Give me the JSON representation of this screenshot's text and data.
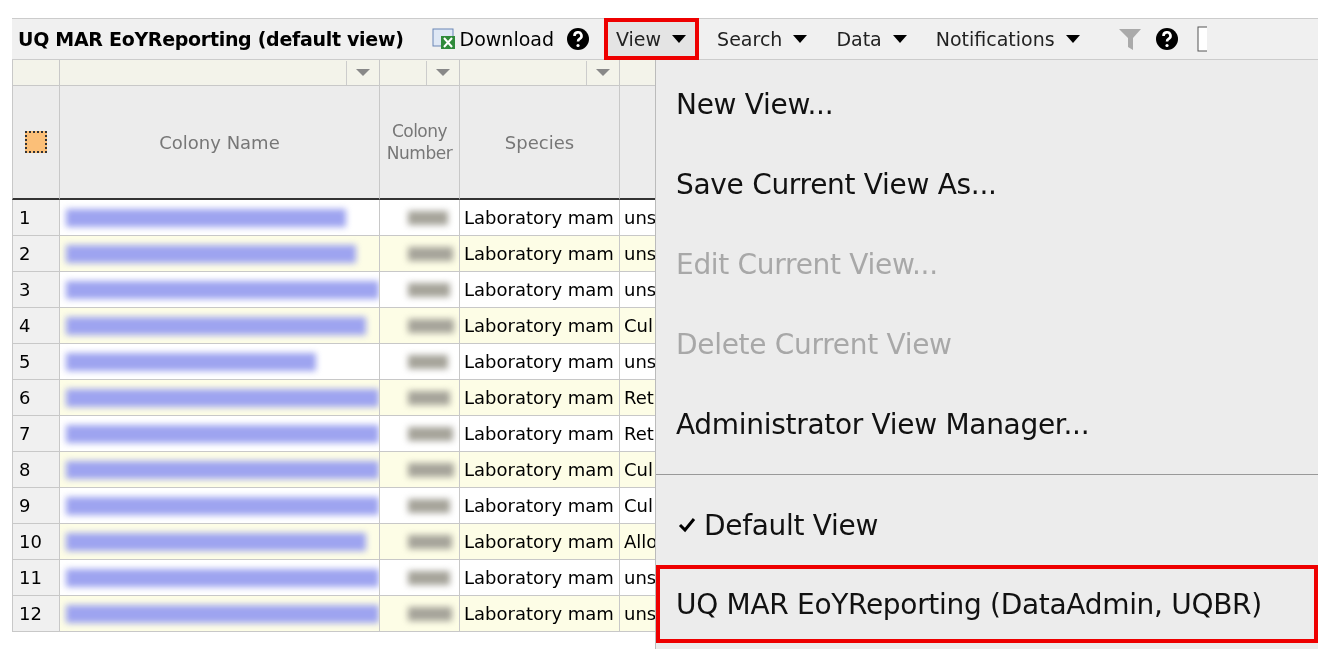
{
  "toolbar": {
    "title": "UQ MAR EoYReporting (default view)",
    "download": "Download",
    "menus": [
      {
        "label": "View",
        "selected": true,
        "outlined": true
      },
      {
        "label": "Search",
        "selected": false,
        "outlined": false
      },
      {
        "label": "Data",
        "selected": false,
        "outlined": false
      },
      {
        "label": "Notifications",
        "selected": false,
        "outlined": false
      }
    ]
  },
  "table": {
    "select_all_checked": false,
    "columns": [
      "Colony Name",
      "Colony Number",
      "Species"
    ],
    "rows": [
      {
        "num": "1",
        "species": "Laboratory mam",
        "column_5": "uns"
      },
      {
        "num": "2",
        "species": "Laboratory mam",
        "column_5": "uns"
      },
      {
        "num": "3",
        "species": "Laboratory mam",
        "column_5": "uns"
      },
      {
        "num": "4",
        "species": "Laboratory mam",
        "column_5": "Cul"
      },
      {
        "num": "5",
        "species": "Laboratory mam",
        "column_5": "uns"
      },
      {
        "num": "6",
        "species": "Laboratory mam",
        "column_5": "Ret"
      },
      {
        "num": "7",
        "species": "Laboratory mam",
        "column_5": "Ret"
      },
      {
        "num": "8",
        "species": "Laboratory mam",
        "column_5": "Cul"
      },
      {
        "num": "9",
        "species": "Laboratory mam",
        "column_5": "Cul"
      },
      {
        "num": "10",
        "species": "Laboratory mam",
        "column_5": "Allo"
      },
      {
        "num": "11",
        "species": "Laboratory mam",
        "column_5": "uns"
      },
      {
        "num": "12",
        "species": "Laboratory mam",
        "column_5": "uns"
      }
    ]
  },
  "view_menu": [
    {
      "kind": "item",
      "label": "New View...",
      "disabled": false,
      "checked": false,
      "outlined": false
    },
    {
      "kind": "item",
      "label": "Save Current View As...",
      "disabled": false,
      "checked": false,
      "outlined": false
    },
    {
      "kind": "item",
      "label": "Edit Current View...",
      "disabled": true,
      "checked": false,
      "outlined": false
    },
    {
      "kind": "item",
      "label": "Delete Current View",
      "disabled": true,
      "checked": false,
      "outlined": false
    },
    {
      "kind": "item",
      "label": "Administrator View Manager...",
      "disabled": false,
      "checked": false,
      "outlined": false
    },
    {
      "kind": "separator"
    },
    {
      "kind": "item",
      "label": "Default View",
      "disabled": false,
      "checked": true,
      "outlined": false
    },
    {
      "kind": "item",
      "label": "UQ MAR EoYReporting (DataAdmin, UQBR)",
      "disabled": false,
      "checked": false,
      "outlined": true
    }
  ]
}
